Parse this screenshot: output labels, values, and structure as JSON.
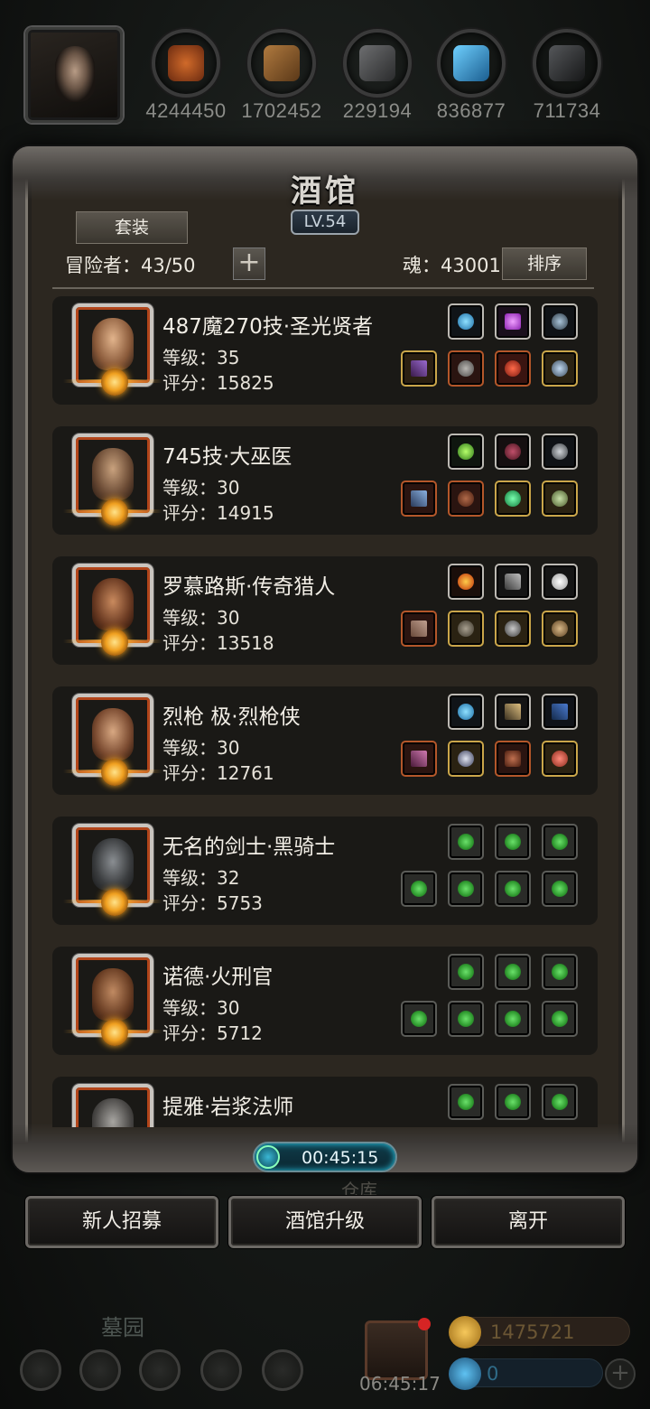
{
  "resources": [
    {
      "value": "4244450",
      "icon": "meat-icon",
      "color": "#9b4a1f"
    },
    {
      "value": "1702452",
      "icon": "wood-icon",
      "color": "#8a5a2e"
    },
    {
      "value": "229194",
      "icon": "iron-ore-icon",
      "color": "#4a4b4d"
    },
    {
      "value": "836877",
      "icon": "crystal-icon",
      "color": "#2a7fb5"
    },
    {
      "value": "711734",
      "icon": "coal-icon",
      "color": "#2e2f31"
    }
  ],
  "panel": {
    "title": "酒馆",
    "level": "LV.54",
    "suit_label": "套装",
    "adventurer_count": "冒险者：43/50",
    "add_label": "+",
    "soul": "魂：43001",
    "sort_label": "排序"
  },
  "heroes": [
    {
      "name": "487魔270技·圣光贤者",
      "level": "等级：35",
      "score": "评分：15825",
      "skin": "#c48c64"
    },
    {
      "name": "745技·大巫医",
      "level": "等级：30",
      "score": "评分：14915",
      "skin": "#9a7658"
    },
    {
      "name": "罗慕路斯·传奇猎人",
      "level": "等级：30",
      "score": "评分：13518",
      "skin": "#a86e4a"
    },
    {
      "name": "烈枪 极·烈枪侠",
      "level": "等级：30",
      "score": "评分：12761",
      "skin": "#b58766"
    },
    {
      "name": "无名的剑士·黑骑士",
      "level": "等级：32",
      "score": "评分：5753",
      "skin": "#55585b"
    },
    {
      "name": "诺德·火刑官",
      "level": "等级：30",
      "score": "评分：5712",
      "skin": "#9a6848"
    },
    {
      "name": "提雅·岩浆法师",
      "level": "",
      "score": "",
      "skin": "#6d6c6a"
    }
  ],
  "timer": "00:45:15",
  "warehouse": "仓库",
  "actions": {
    "recruit": "新人招募",
    "upgrade": "酒馆升级",
    "leave": "离开"
  },
  "hud": {
    "graveyard": "墓园",
    "gift_timer": "06:45:17",
    "gold": "1475721",
    "gems": "0",
    "plus": "+"
  }
}
